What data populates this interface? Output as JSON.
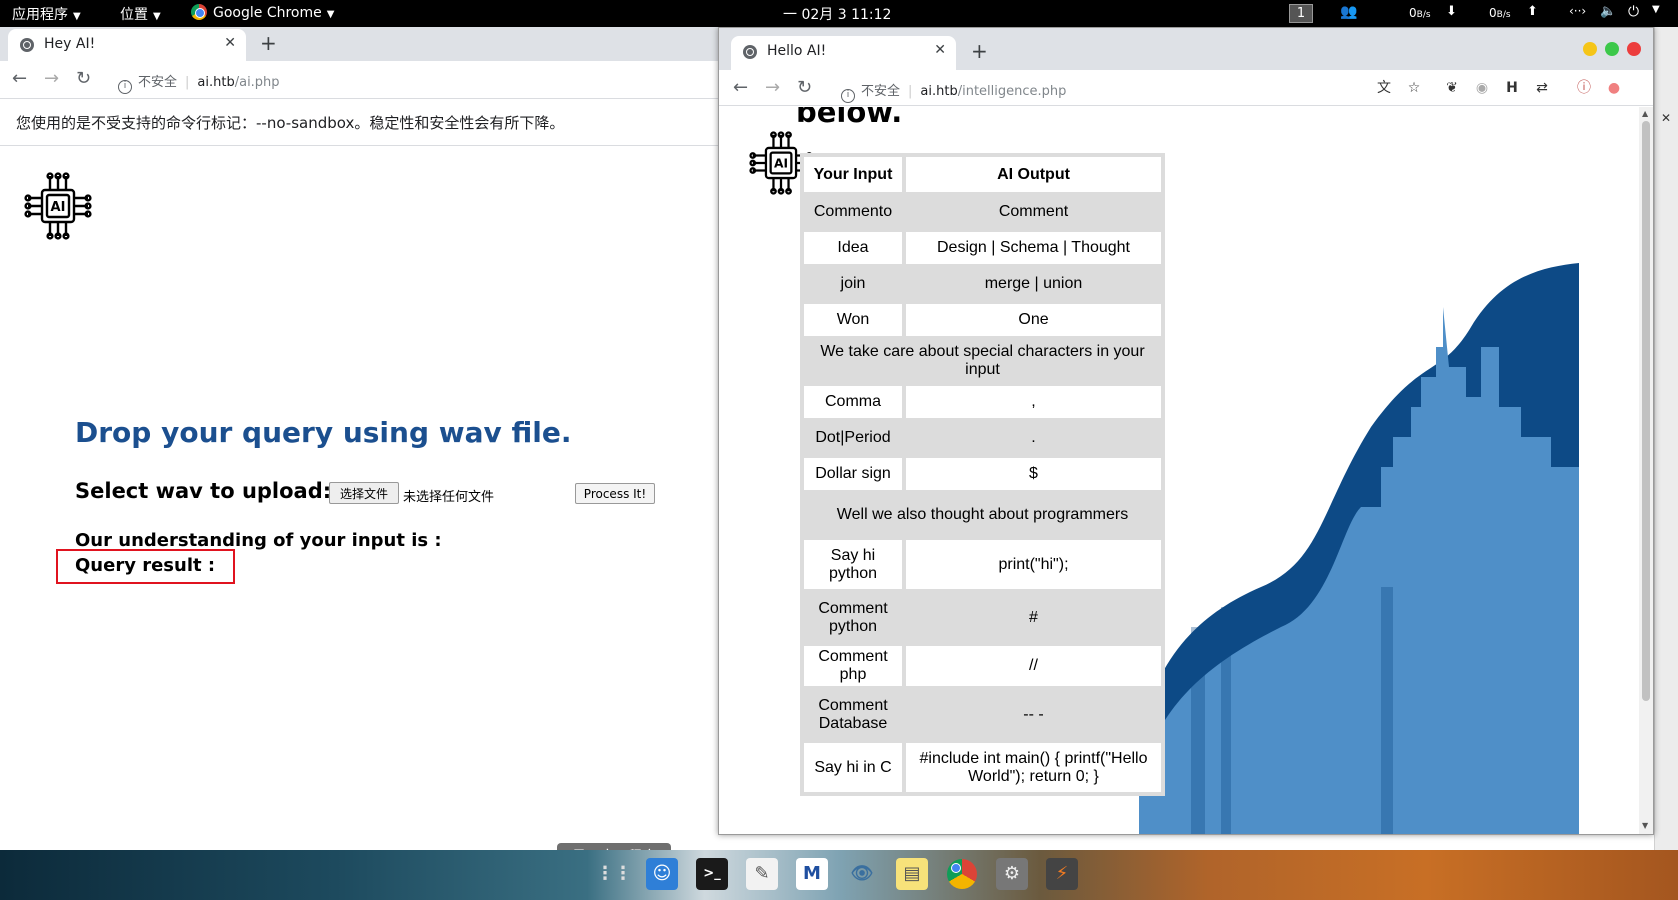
{
  "topbar": {
    "apps_menu": "应用程序",
    "places_menu": "位置",
    "active_app": "Google Chrome",
    "datetime": "一 02月 3  11:12",
    "workspace": "1",
    "net_down": "0",
    "net_up": "0",
    "net_unit": "B/s"
  },
  "left_browser": {
    "tab_title": "Hey AI!",
    "insecure_label": "不安全",
    "url_host": "ai.htb",
    "url_path": "/ai.php",
    "infobar": "您使用的是不受支持的命令行标记：--no-sandbox。稳定性和安全性会有所下降。",
    "page": {
      "logo_text": "AI",
      "heading": "Drop your query using wav file.",
      "upload_label": "Select wav to upload:",
      "choose_file_button": "选择文件",
      "no_file_chosen": "未选择任何文件",
      "process_button": "Process It!",
      "understanding_label": "Our understanding of your input is :",
      "query_result_label": "Query result :"
    },
    "show_apps_tooltip": "显示应用程序"
  },
  "right_browser": {
    "tab_title": "Hello AI!",
    "insecure_label": "不安全",
    "url_host": "ai.htb",
    "url_path": "/intelligence.php",
    "page": {
      "heading_fragment": "below.",
      "logo_text": "AI",
      "table": {
        "headers": [
          "Your Input",
          "AI Output"
        ],
        "rows": [
          {
            "input": "Commento",
            "output": "Comment",
            "shade": "g"
          },
          {
            "input": "Idea",
            "output": "Design | Schema | Thought",
            "shade": "w"
          },
          {
            "input": "join",
            "output": "merge | union",
            "shade": "g"
          },
          {
            "input": "Won",
            "output": "One",
            "shade": "w"
          },
          {
            "section": "We take care about special characters in your input"
          },
          {
            "input": "Comma",
            "output": ",",
            "shade": "w"
          },
          {
            "input": "Dot|Period",
            "output": ".",
            "shade": "g"
          },
          {
            "input": "Dollar sign",
            "output": "$",
            "shade": "w"
          },
          {
            "section": "Well we also thought about programmers"
          },
          {
            "input": "Say hi python",
            "output": "print(\"hi\");",
            "shade": "w"
          },
          {
            "input": "Comment python",
            "output": "#",
            "shade": "g"
          },
          {
            "input": "Comment php",
            "output": "//",
            "shade": "w"
          },
          {
            "input": "Comment Database",
            "output": "-- -",
            "shade": "g"
          },
          {
            "input": "Say hi in C",
            "output": "#include int main() { printf(\"Hello World\"); return 0; }",
            "shade": "w"
          }
        ]
      }
    }
  },
  "colors": {
    "heading_blue": "#1b4f8f",
    "highlight_red": "#e0131f",
    "wave_dark": "#0d4a86",
    "wave_light": "#4f8fc8"
  }
}
